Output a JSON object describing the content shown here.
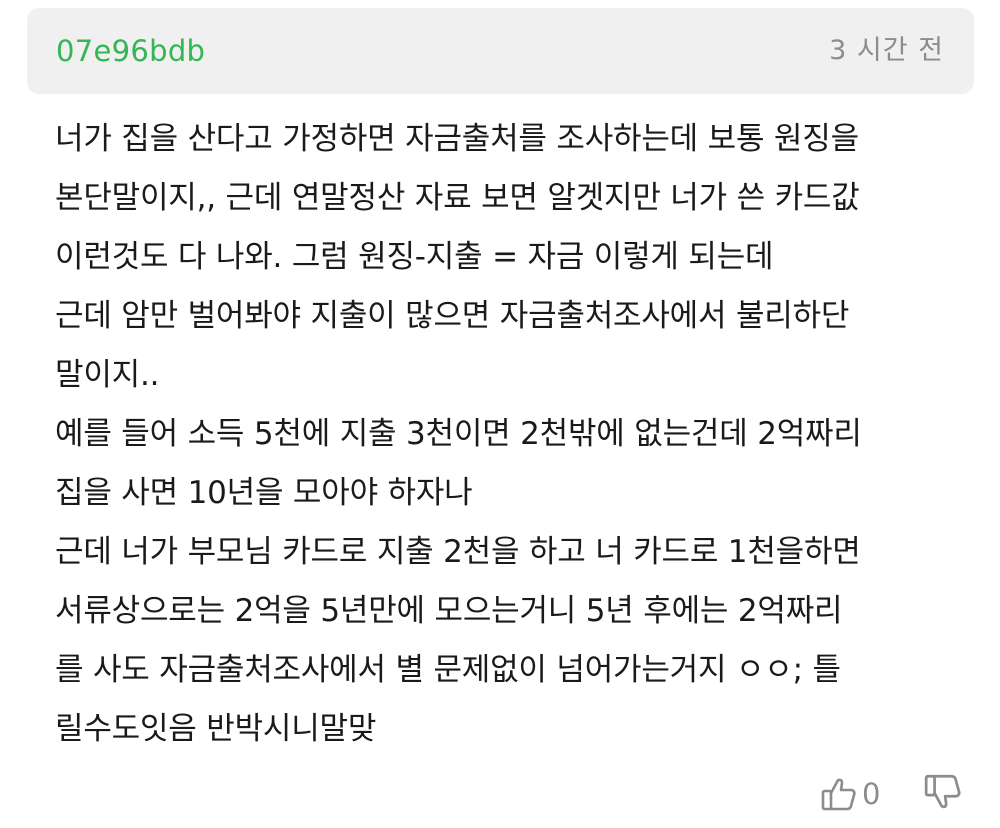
{
  "comment": {
    "author": "07e96bdb",
    "timestamp": "3 시간 전",
    "body_lines": [
      "너가 집을 산다고 가정하면 자금출처를 조사하는데 보통 원징을",
      "본단말이지,, 근데 연말정산 자료 보면 알겟지만 너가 쓴 카드값",
      "이런것도 다 나와. 그럼 원징-지출 = 자금 이렇게 되는데",
      "근데 암만 벌어봐야 지출이 많으면 자금출처조사에서 불리하단",
      "말이지..",
      "예를 들어 소득 5천에 지출 3천이면 2천밖에 없는건데 2억짜리",
      "집을 사면 10년을 모아야 하자나",
      "근데 너가 부모님 카드로 지출 2천을 하고 너 카드로 1천을하면",
      "서류상으로는 2억을 5년만에 모으는거니 5년 후에는 2억짜리",
      "를 사도 자금출처조사에서 별 문제없이 넘어가는거지 ㅇㅇ; 틀",
      "릴수도잇음 반박시니말맞"
    ],
    "like_count": "0"
  },
  "colors": {
    "author": "#33b653",
    "header_bg": "#f0f0f0",
    "muted": "#8c8c8c",
    "body_text": "#1a1a1a"
  },
  "icons": {
    "like": "thumbs-up-outline-icon",
    "dislike": "thumbs-down-outline-icon"
  }
}
